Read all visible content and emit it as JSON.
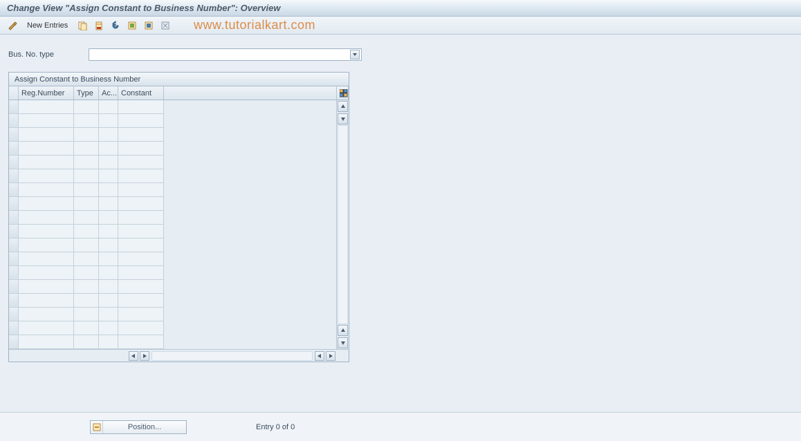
{
  "header": {
    "title": "Change View \"Assign Constant to Business Number\": Overview"
  },
  "toolbar": {
    "new_entries_label": "New Entries",
    "watermark": "www.tutorialkart.com"
  },
  "form": {
    "bus_no_type_label": "Bus. No. type",
    "bus_no_type_value": ""
  },
  "grid": {
    "title": "Assign Constant to Business Number",
    "columns": {
      "reg": "Reg.Number",
      "type": "Type",
      "ac": "Ac...",
      "const": "Constant"
    },
    "rows": [
      "",
      "",
      "",
      "",
      "",
      "",
      "",
      "",
      "",
      "",
      "",
      "",
      "",
      "",
      "",
      "",
      "",
      ""
    ]
  },
  "footer": {
    "position_label": "Position...",
    "entry_text": "Entry 0 of 0"
  }
}
